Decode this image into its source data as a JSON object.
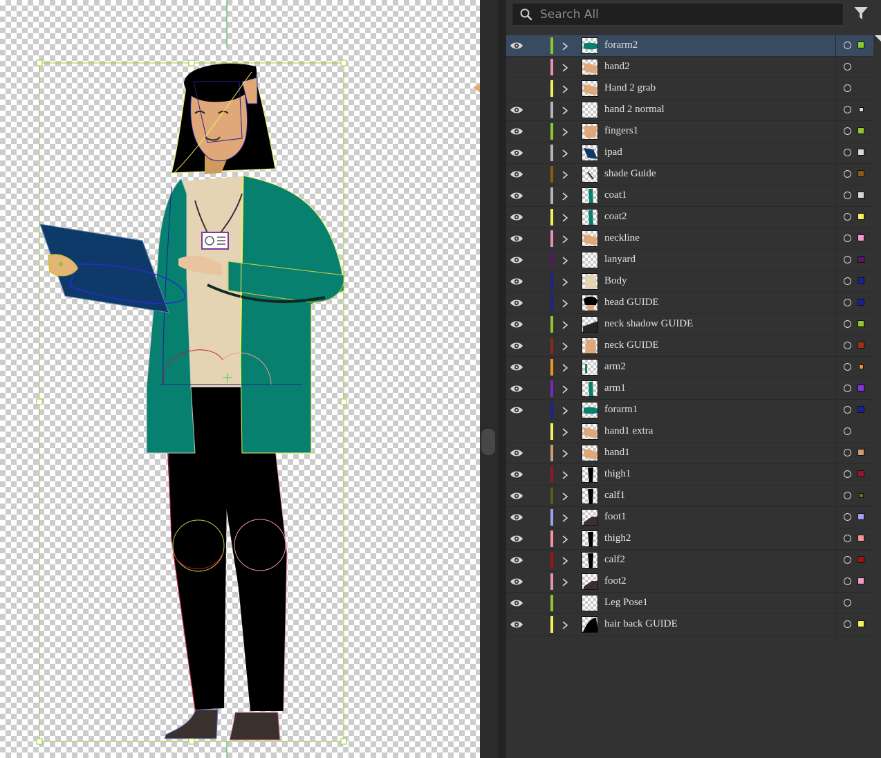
{
  "search": {
    "placeholder": "Search All"
  },
  "icons": {
    "search": "magnifier-icon",
    "filter": "funnel-icon",
    "visibility": "eye-icon",
    "expand": "chevron-right-icon",
    "target": "circle-target-icon"
  },
  "colors": {
    "panel_bg": "#323232",
    "selected_row": "#394b61",
    "text": "#e2e2e2"
  },
  "layers": [
    {
      "name": "forarm2",
      "visible": true,
      "selected": true,
      "expandable": true,
      "bar": "#8cc832",
      "swatch": "#8cc832",
      "thumb": "teal-strip"
    },
    {
      "name": "hand2",
      "visible": false,
      "expandable": true,
      "bar": "#e88fb5",
      "swatch": null,
      "thumb": "skin"
    },
    {
      "name": "Hand 2 grab",
      "visible": false,
      "expandable": true,
      "bar": "#f2f25a",
      "swatch": null,
      "thumb": "skin"
    },
    {
      "name": "hand 2 normal",
      "visible": true,
      "expandable": true,
      "bar": "#b4b4b4",
      "swatch": "#d8d8d8",
      "small": true,
      "thumb": "empty"
    },
    {
      "name": "fingers1",
      "visible": true,
      "expandable": true,
      "bar": "#8cc832",
      "swatch": "#8cc832",
      "thumb": "skin-blob"
    },
    {
      "name": "ipad",
      "visible": true,
      "expandable": true,
      "bar": "#b4b4b4",
      "swatch": "#d8d8d8",
      "thumb": "navy"
    },
    {
      "name": "shade Guide",
      "visible": true,
      "expandable": true,
      "bar": "#8c5a14",
      "swatch": "#8c5a14",
      "thumb": "empty-mark"
    },
    {
      "name": "coat1",
      "visible": true,
      "expandable": true,
      "bar": "#b4b4b4",
      "swatch": "#d8d8d8",
      "thumb": "teal-vert"
    },
    {
      "name": "coat2",
      "visible": true,
      "expandable": true,
      "bar": "#f2f25a",
      "swatch": "#f2f25a",
      "thumb": "teal-vert"
    },
    {
      "name": "neckline",
      "visible": true,
      "expandable": true,
      "bar": "#e88fb5",
      "swatch": "#f29ac8",
      "thumb": "skin"
    },
    {
      "name": "lanyard",
      "visible": true,
      "expandable": true,
      "bar": "#5a1466",
      "swatch": "#5a1466",
      "thumb": "empty"
    },
    {
      "name": "Body",
      "visible": true,
      "expandable": true,
      "bar": "#1e1e96",
      "swatch": "#1e1e96",
      "thumb": "beige"
    },
    {
      "name": "head GUIDE",
      "visible": true,
      "expandable": true,
      "bar": "#1e1e96",
      "swatch": "#1e1e96",
      "thumb": "hair-head"
    },
    {
      "name": "neck shadow GUIDE",
      "visible": true,
      "expandable": true,
      "bar": "#8cc832",
      "swatch": "#8cc832",
      "thumb": "dark-slope"
    },
    {
      "name": "neck GUIDE",
      "visible": true,
      "expandable": true,
      "bar": "#8c2a14",
      "swatch": "#a03214",
      "thumb": "skin-neck"
    },
    {
      "name": "arm2",
      "visible": true,
      "expandable": true,
      "bar": "#f0961e",
      "swatch": "#f0961e",
      "small": true,
      "thumb": "teal-thin"
    },
    {
      "name": "arm1",
      "visible": true,
      "expandable": true,
      "bar": "#7828c8",
      "swatch": "#8c32e6",
      "thumb": "teal-vert"
    },
    {
      "name": "forarm1",
      "visible": true,
      "expandable": true,
      "bar": "#1e1e96",
      "swatch": "#1e1e96",
      "thumb": "teal-strip"
    },
    {
      "name": "hand1 extra",
      "visible": false,
      "expandable": true,
      "bar": "#f2f25a",
      "swatch": null,
      "thumb": "skin"
    },
    {
      "name": "hand1",
      "visible": true,
      "expandable": true,
      "bar": "#d29a6e",
      "swatch": "#d29a6e",
      "thumb": "skin"
    },
    {
      "name": "thigh1",
      "visible": true,
      "expandable": true,
      "bar": "#961432",
      "swatch": "#961432",
      "thumb": "black-leg"
    },
    {
      "name": "calf1",
      "visible": true,
      "expandable": true,
      "bar": "#5a5a1e",
      "swatch": "#6e6e1e",
      "small": true,
      "thumb": "black-leg"
    },
    {
      "name": "foot1",
      "visible": true,
      "expandable": true,
      "bar": "#a0a0f0",
      "swatch": "#a0a0f0",
      "thumb": "foot"
    },
    {
      "name": "thigh2",
      "visible": true,
      "expandable": true,
      "bar": "#f29696",
      "swatch": "#f29696",
      "thumb": "black-leg"
    },
    {
      "name": "calf2",
      "visible": true,
      "expandable": true,
      "bar": "#a01414",
      "swatch": "#a01414",
      "thumb": "black-leg"
    },
    {
      "name": "foot2",
      "visible": true,
      "expandable": true,
      "bar": "#e88fb5",
      "swatch": "#f29ac8",
      "thumb": "foot"
    },
    {
      "name": "Leg Pose1",
      "visible": true,
      "expandable": false,
      "bar": "#8cc832",
      "swatch": null,
      "thumb": "empty"
    },
    {
      "name": "hair back GUIDE",
      "visible": true,
      "expandable": true,
      "bar": "#f2f25a",
      "swatch": "#f2f25a",
      "thumb": "black-shape"
    }
  ]
}
